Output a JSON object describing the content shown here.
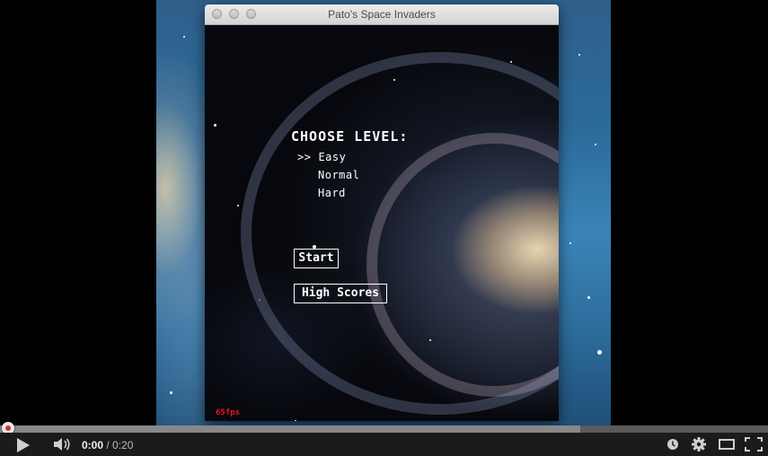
{
  "window": {
    "title": "Pato's Space Invaders"
  },
  "menu": {
    "heading": "CHOOSE LEVEL:",
    "cursor": ">>",
    "levels": [
      "Easy",
      "Normal",
      "Hard"
    ],
    "selected_level": "Easy",
    "start_label": "Start",
    "high_scores_label": "High Scores"
  },
  "hud": {
    "fps": "65fps"
  },
  "player": {
    "current_time": "0:00",
    "separator": " / ",
    "duration": "0:20",
    "played_fraction": 0.0,
    "buffered_fraction": 0.755,
    "icons": [
      "play-icon",
      "volume-icon",
      "watch-later-icon",
      "settings-gear-icon",
      "theater-mode-icon",
      "fullscreen-icon"
    ]
  },
  "colors": {
    "fps_text": "#e01818",
    "menu_text": "#ffffff",
    "player_bar": "#1b1b1b"
  }
}
